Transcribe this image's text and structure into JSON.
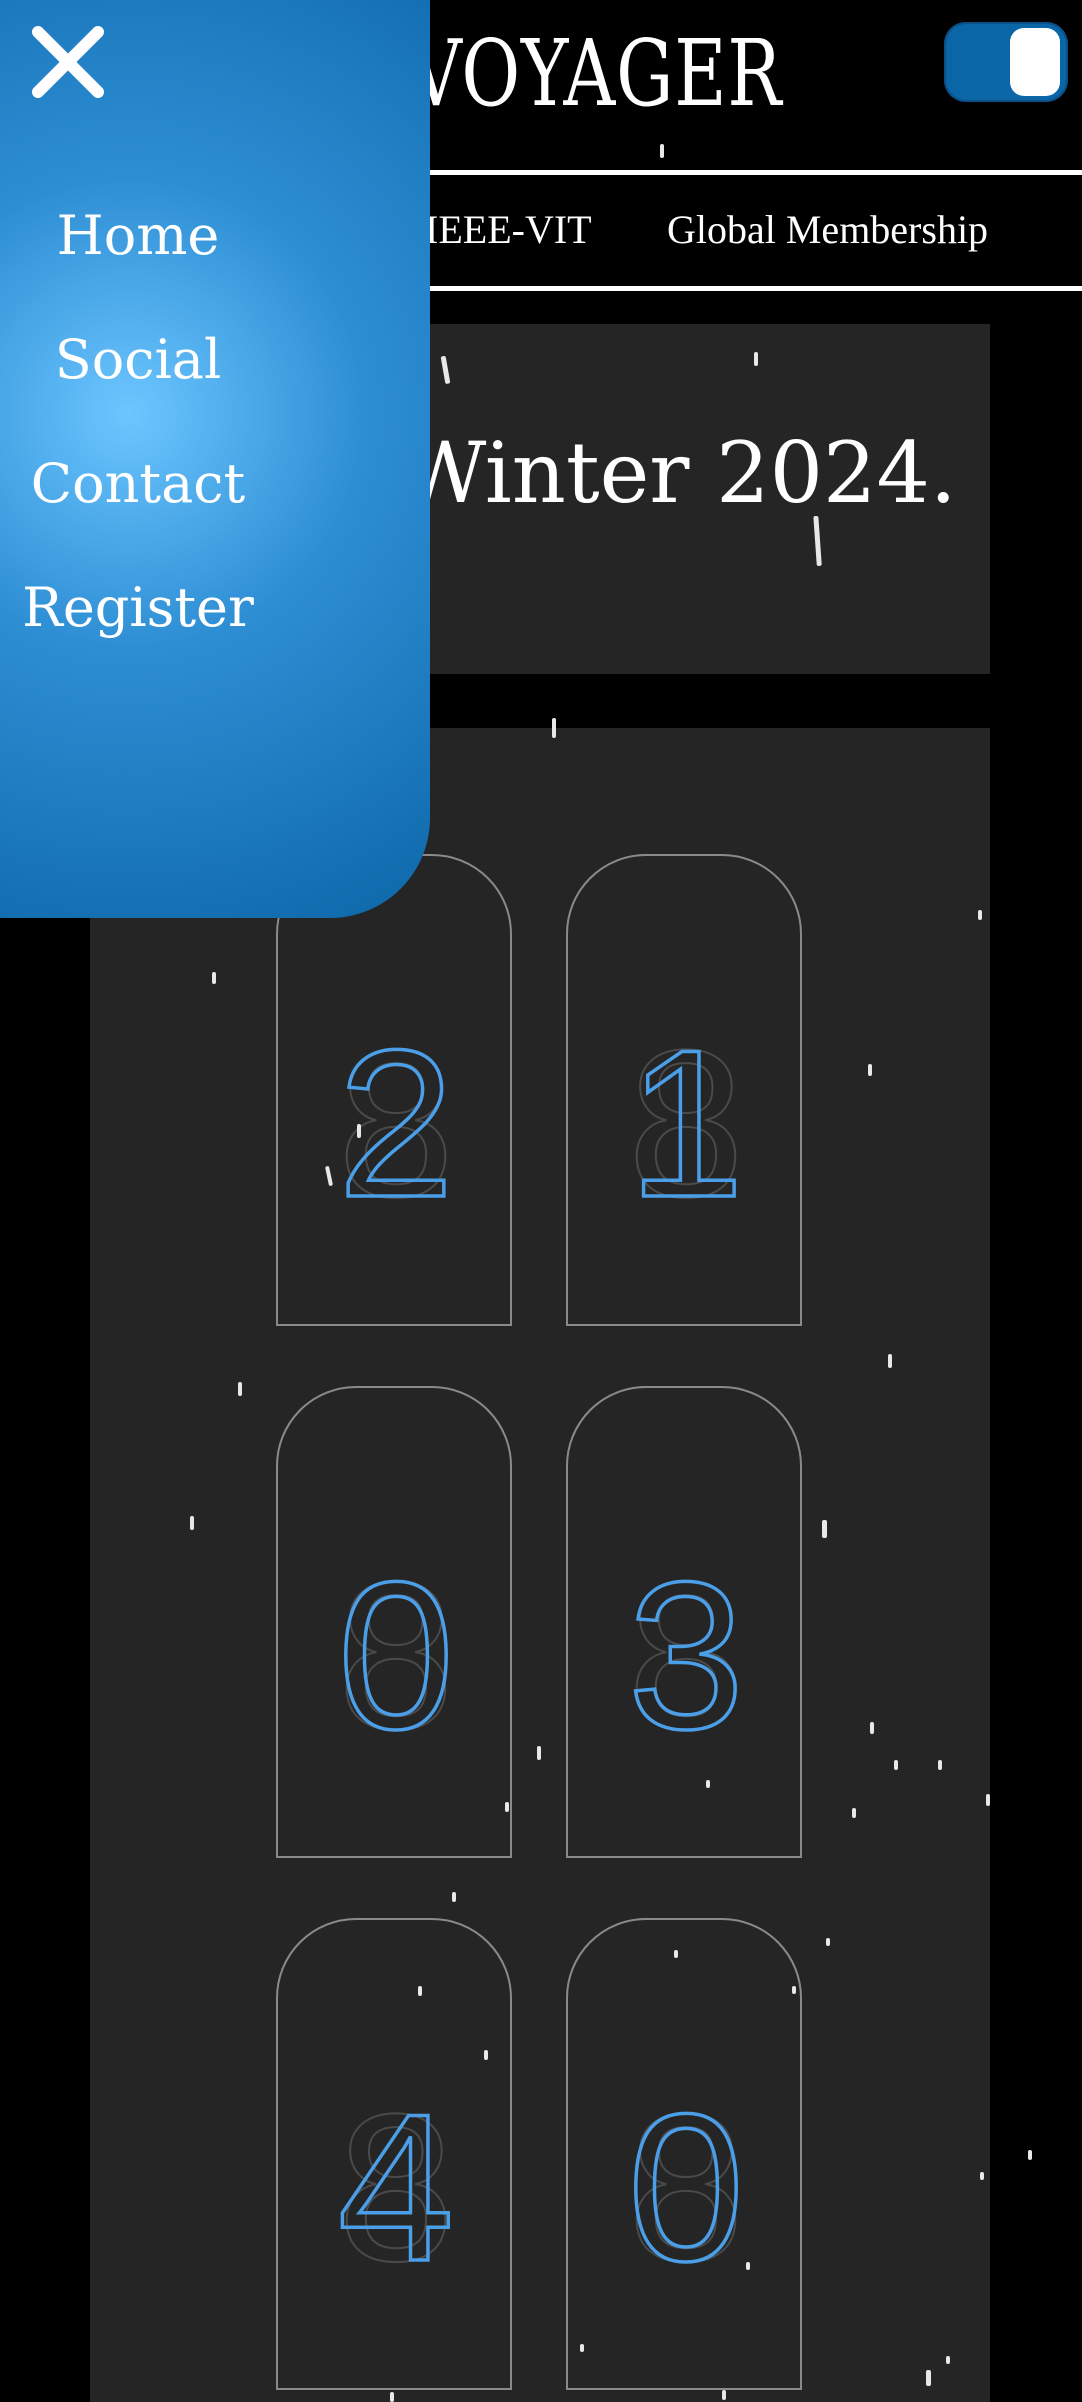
{
  "header": {
    "logo_text": "VOYAGER",
    "theme_toggle_state": "on"
  },
  "nav": {
    "items": [
      {
        "label": "IEEE-VIT"
      },
      {
        "label": "Global Membership"
      }
    ]
  },
  "hero": {
    "text": "Winter 2024."
  },
  "countdown": {
    "digits": [
      "2",
      "1",
      "0",
      "3",
      "4",
      "0"
    ]
  },
  "side_menu": {
    "items": [
      {
        "label": "Home"
      },
      {
        "label": "Social"
      },
      {
        "label": "Contact"
      },
      {
        "label": "Register"
      }
    ]
  },
  "colors": {
    "accent": "#4a9fe8",
    "menu_bg": "#2e8ed4",
    "panel": "#252525"
  }
}
